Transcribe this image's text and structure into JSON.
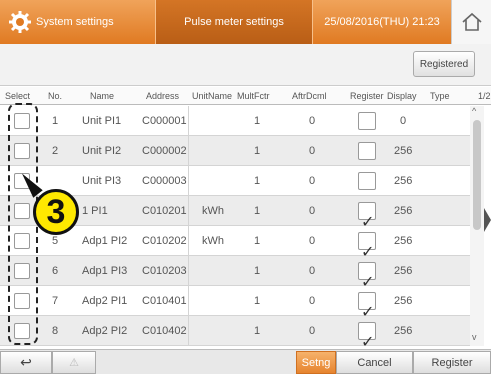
{
  "header": {
    "title": "System settings",
    "active_tab": "Pulse meter settings",
    "datetime": "25/08/2016(THU) 21:23"
  },
  "toolbar": {
    "registered_label": "Registered"
  },
  "columns": {
    "select": "Select",
    "no": "No.",
    "name": "Name",
    "address": "Address",
    "unit_name": "UnitName",
    "mult_fctr": "MultFctr",
    "aftr_dcml": "AftrDcml",
    "register": "Register",
    "display": "Display",
    "type": "Type",
    "page": "1/2"
  },
  "rows": [
    {
      "no": "1",
      "name": "Unit PI1",
      "address": "C000001",
      "unit": "",
      "mult": "1",
      "dcml": "0",
      "registered": false,
      "display": "0"
    },
    {
      "no": "2",
      "name": "Unit PI2",
      "address": "C000002",
      "unit": "",
      "mult": "1",
      "dcml": "0",
      "registered": false,
      "display": "256"
    },
    {
      "no": "",
      "name": "Unit PI3",
      "address": "C000003",
      "unit": "",
      "mult": "1",
      "dcml": "0",
      "registered": false,
      "display": "256"
    },
    {
      "no": "",
      "name": "1 PI1",
      "address": "C010201",
      "unit": "kWh",
      "mult": "1",
      "dcml": "0",
      "registered": true,
      "display": "256"
    },
    {
      "no": "5",
      "name": "Adp1 PI2",
      "address": "C010202",
      "unit": "kWh",
      "mult": "1",
      "dcml": "0",
      "registered": true,
      "display": "256"
    },
    {
      "no": "6",
      "name": "Adp1 PI3",
      "address": "C010203",
      "unit": "",
      "mult": "1",
      "dcml": "0",
      "registered": true,
      "display": "256"
    },
    {
      "no": "7",
      "name": "Adp2 PI1",
      "address": "C010401",
      "unit": "",
      "mult": "1",
      "dcml": "0",
      "registered": true,
      "display": "256"
    },
    {
      "no": "8",
      "name": "Adp2 PI2",
      "address": "C010402",
      "unit": "",
      "mult": "1",
      "dcml": "0",
      "registered": true,
      "display": "256"
    }
  ],
  "annotation": {
    "number": "3"
  },
  "bottom": {
    "back_icon": "↩",
    "warning_icon": "⚠",
    "setng_label": "Setng",
    "cancel_label": "Cancel",
    "register_label": "Register"
  },
  "colors": {
    "header_orange": "#e07a22",
    "active_tab": "#b95e16",
    "annotation_yellow": "#ffe800"
  }
}
